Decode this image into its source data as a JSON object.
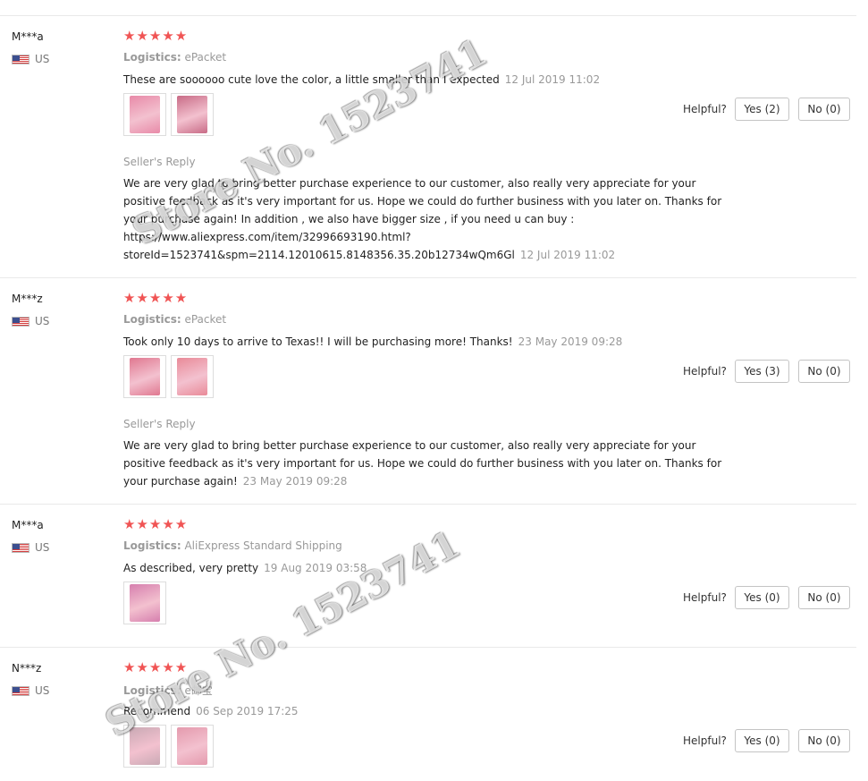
{
  "labels": {
    "logistics": "Logistics:",
    "helpful": "Helpful?",
    "seller_reply": "Seller's Reply",
    "stars": "★★★★★"
  },
  "watermark": "Store No. 1523741",
  "reviews": [
    {
      "user": "M***a",
      "country": "US",
      "rating": 5,
      "logistics": "ePacket",
      "text": "These are soooooo cute love the color, a little smaller than I expected",
      "date": "12 Jul 2019 11:02",
      "photo_colors": [
        "#e88aa8",
        "#c86b86"
      ],
      "yes": "Yes (2)",
      "no": "No (0)",
      "reply_lines": [
        "We are very glad to bring better purchase experience to our customer, also really very appreciate for your",
        "positive feedback as it's very important for us. Hope we could do further business with you later on. Thanks for",
        "your purchase again! In addition , we also have bigger size , if you need u can buy :",
        "https://www.aliexpress.com/item/32996693190.html?",
        "storeId=1523741&spm=2114.12010615.8148356.35.20b12734wQm6Gl"
      ],
      "reply_date": "12 Jul 2019 11:02"
    },
    {
      "user": "M***z",
      "country": "US",
      "rating": 5,
      "logistics": "ePacket",
      "text": "Took only 10 days to arrive to Texas!! I will be purchasing more! Thanks!",
      "date": "23 May 2019 09:28",
      "photo_colors": [
        "#e07890",
        "#e98a98"
      ],
      "yes": "Yes (3)",
      "no": "No (0)",
      "reply_lines": [
        "We are very glad to bring better purchase experience to our customer, also really very appreciate for your",
        "positive feedback as it's very important for us. Hope we could do further business with you later on. Thanks for",
        "your purchase again!"
      ],
      "reply_date": "23 May 2019 09:28"
    },
    {
      "user": "M***a",
      "country": "US",
      "rating": 5,
      "logistics": "AliExpress Standard Shipping",
      "text": "As described, very pretty",
      "date": "19 Aug 2019 03:58",
      "photo_colors": [
        "#d67fae"
      ],
      "yes": "Yes (0)",
      "no": "No (0)"
    },
    {
      "user": "N***z",
      "country": "US",
      "rating": 5,
      "logistics": "e邮宝",
      "text": "Recommend",
      "date": "06 Sep 2019 17:25",
      "photo_colors": [
        "#c9a9b4",
        "#e49aad"
      ],
      "yes": "Yes (0)",
      "no": "No (0)"
    }
  ]
}
